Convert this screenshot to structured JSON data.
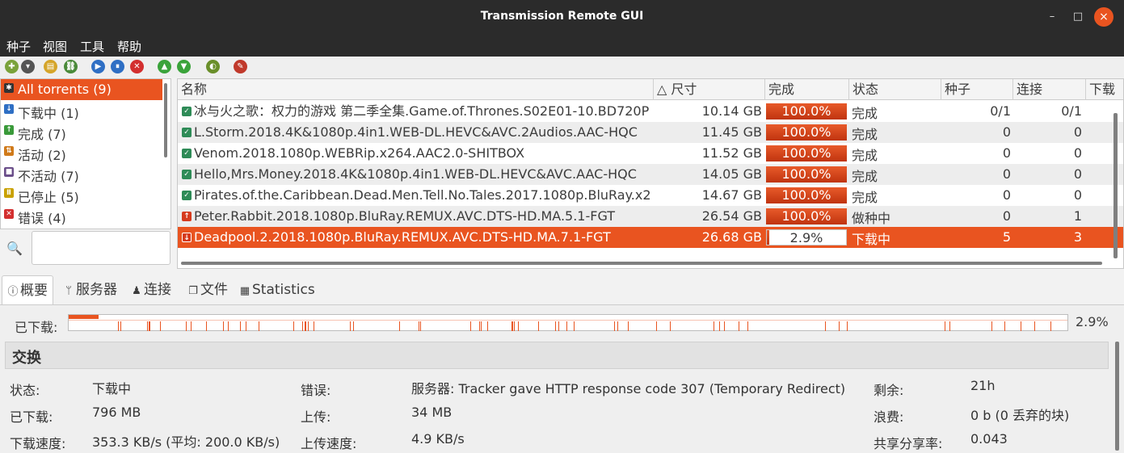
{
  "window": {
    "title": "Transmission Remote GUI",
    "minimize": "–",
    "maximize": "□",
    "close": "×"
  },
  "menubar": {
    "items": [
      "种子",
      "视图",
      "工具",
      "帮助"
    ]
  },
  "toolbar": {
    "buttons": [
      {
        "name": "add-torrent-icon",
        "glyph": "✚",
        "color": "#7aa23a"
      },
      {
        "name": "dropdown-arrow-icon",
        "glyph": "▾",
        "color": "#555555"
      },
      {
        "name": "open-folder-icon",
        "glyph": "▤",
        "color": "#d5a52a"
      },
      {
        "name": "add-link-icon",
        "glyph": "⛓",
        "color": "#4a8a3a"
      },
      {
        "name": "start-icon",
        "glyph": "▶",
        "color": "#2f6fc4"
      },
      {
        "name": "pause-icon",
        "glyph": "⏸",
        "color": "#2f6fc4"
      },
      {
        "name": "stop-icon",
        "glyph": "✕",
        "color": "#d32f2f"
      },
      {
        "name": "move-up-icon",
        "glyph": "▲",
        "color": "#3aa33a"
      },
      {
        "name": "move-down-icon",
        "glyph": "▼",
        "color": "#3aa33a"
      },
      {
        "name": "turtle-icon",
        "glyph": "◐",
        "color": "#6a8f2a"
      },
      {
        "name": "settings-icon",
        "glyph": "✎",
        "color": "#c0392b"
      }
    ]
  },
  "filters": {
    "items": [
      {
        "label": "All torrents (9)",
        "icon": "✱",
        "color": "#333333",
        "selected": true
      },
      {
        "label": "下载中 (1)",
        "icon": "↓",
        "color": "#2f6fc4",
        "selected": false
      },
      {
        "label": "完成 (7)",
        "icon": "↑",
        "color": "#3a9a3a",
        "selected": false
      },
      {
        "label": "活动 (2)",
        "icon": "⇅",
        "color": "#d07a1a",
        "selected": false
      },
      {
        "label": "不活动 (7)",
        "icon": "■",
        "color": "#6b4f8a",
        "selected": false
      },
      {
        "label": "已停止 (5)",
        "icon": "Ⅱ",
        "color": "#c9a100",
        "selected": false
      },
      {
        "label": "错误 (4)",
        "icon": "✕",
        "color": "#d32f2f",
        "selected": false
      }
    ],
    "search_placeholder": ""
  },
  "table": {
    "columns": [
      "名称",
      "△ 尺寸",
      "完成",
      "状态",
      "种子",
      "连接",
      "下载"
    ],
    "rows": [
      {
        "name": "冰与火之歌：权力的游戏 第二季全集.Game.of.Thrones.S02E01-10.BD720P",
        "size": "10.14 GB",
        "done": "100.0%",
        "done_value": 100,
        "status": "完成",
        "seeds": "0/1",
        "peers": "0/1",
        "icon": "done"
      },
      {
        "name": "L.Storm.2018.4K&1080p.4in1.WEB-DL.HEVC&AVC.2Audios.AAC-HQC",
        "size": "11.45 GB",
        "done": "100.0%",
        "done_value": 100,
        "status": "完成",
        "seeds": "0",
        "peers": "0",
        "icon": "done"
      },
      {
        "name": "Venom.2018.1080p.WEBRip.x264.AAC2.0-SHITBOX",
        "size": "11.52 GB",
        "done": "100.0%",
        "done_value": 100,
        "status": "完成",
        "seeds": "0",
        "peers": "0",
        "icon": "done"
      },
      {
        "name": "Hello,Mrs.Money.2018.4K&1080p.4in1.WEB-DL.HEVC&AVC.AAC-HQC",
        "size": "14.05 GB",
        "done": "100.0%",
        "done_value": 100,
        "status": "完成",
        "seeds": "0",
        "peers": "0",
        "icon": "done"
      },
      {
        "name": "Pirates.of.the.Caribbean.Dead.Men.Tell.No.Tales.2017.1080p.BluRay.x264",
        "size": "14.67 GB",
        "done": "100.0%",
        "done_value": 100,
        "status": "完成",
        "seeds": "0",
        "peers": "0",
        "icon": "done"
      },
      {
        "name": "Peter.Rabbit.2018.1080p.BluRay.REMUX.AVC.DTS-HD.MA.5.1-FGT",
        "size": "26.54 GB",
        "done": "100.0%",
        "done_value": 100,
        "status": "做种中",
        "seeds": "0",
        "peers": "1",
        "icon": "seed"
      },
      {
        "name": "Deadpool.2.2018.1080p.BluRay.REMUX.AVC.DTS-HD.MA.7.1-FGT",
        "size": "26.68 GB",
        "done": "2.9%",
        "done_value": 2.9,
        "status": "下载中",
        "seeds": "5",
        "peers": "3",
        "icon": "dl",
        "selected": true
      }
    ]
  },
  "tabs": [
    {
      "label": "概要",
      "icon": "ⓘ",
      "active": true
    },
    {
      "label": "服务器",
      "icon": "ᛘ",
      "active": false
    },
    {
      "label": "连接",
      "icon": "♟",
      "active": false
    },
    {
      "label": "文件",
      "icon": "❐",
      "active": false
    },
    {
      "label": "Statistics",
      "icon": "▦",
      "active": false
    }
  ],
  "details": {
    "downloaded_label": "已下载:",
    "downloaded_pct": "2.9%",
    "progress_value": 2.9,
    "section_title": "交换",
    "fields": [
      {
        "label": "状态:",
        "value": "下载中"
      },
      {
        "label": "已下载:",
        "value": "796 MB"
      },
      {
        "label": "下载速度:",
        "value": "353.3 KB/s (平均: 200.0 KB/s)"
      },
      {
        "label": "错误:",
        "value": "服务器: Tracker gave HTTP response code 307 (Temporary Redirect)"
      },
      {
        "label": "上传:",
        "value": "34 MB"
      },
      {
        "label": "上传速度:",
        "value": "4.9 KB/s"
      },
      {
        "label": "剩余:",
        "value": "21h"
      },
      {
        "label": "浪费:",
        "value": "0 b (0 丢弃的块)"
      },
      {
        "label": "共享分享率:",
        "value": "0.043"
      }
    ]
  }
}
